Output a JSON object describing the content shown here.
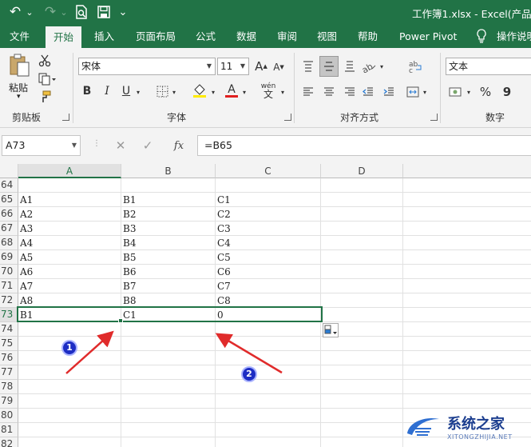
{
  "window": {
    "title": "工作簿1.xlsx  -  Excel(产品"
  },
  "quick_access": {
    "undo_icon": "↶",
    "redo_icon": "↷",
    "dropdown_icon": "⌄"
  },
  "tabs": [
    {
      "label": "文件"
    },
    {
      "label": "开始"
    },
    {
      "label": "插入"
    },
    {
      "label": "页面布局"
    },
    {
      "label": "公式"
    },
    {
      "label": "数据"
    },
    {
      "label": "审阅"
    },
    {
      "label": "视图"
    },
    {
      "label": "帮助"
    },
    {
      "label": "Power Pivot"
    },
    {
      "label": "操作说明"
    }
  ],
  "ribbon": {
    "clipboard": {
      "group_label": "剪贴板",
      "paste_label": "粘贴"
    },
    "font": {
      "group_label": "字体",
      "font_name": "宋体",
      "font_size": "11",
      "bold": "B",
      "italic": "I",
      "underline": "U",
      "grow": "A",
      "shrink": "A",
      "color_letter": "A",
      "phonetic": "wén",
      "accent_color": "#e02020",
      "highlight_color": "#ffeb00"
    },
    "alignment": {
      "group_label": "对齐方式"
    },
    "number": {
      "group_label": "数字",
      "format": "文本",
      "percent": "%",
      "comma": "9"
    }
  },
  "formula_bar": {
    "name_box": "A73",
    "fx": "fx",
    "formula": "=B65"
  },
  "sheet": {
    "columns": [
      "A",
      "B",
      "C",
      "D"
    ],
    "rows": [
      {
        "num": "64",
        "cells": [
          "",
          "",
          ""
        ]
      },
      {
        "num": "65",
        "cells": [
          "A1",
          "B1",
          "C1"
        ]
      },
      {
        "num": "66",
        "cells": [
          "A2",
          "B2",
          "C2"
        ]
      },
      {
        "num": "67",
        "cells": [
          "A3",
          "B3",
          "C3"
        ]
      },
      {
        "num": "68",
        "cells": [
          "A4",
          "B4",
          "C4"
        ]
      },
      {
        "num": "69",
        "cells": [
          "A5",
          "B5",
          "C5"
        ]
      },
      {
        "num": "70",
        "cells": [
          "A6",
          "B6",
          "C6"
        ]
      },
      {
        "num": "71",
        "cells": [
          "A7",
          "B7",
          "C7"
        ]
      },
      {
        "num": "72",
        "cells": [
          "A8",
          "B8",
          "C8"
        ]
      },
      {
        "num": "73",
        "cells": [
          "B1",
          "C1",
          "0"
        ]
      },
      {
        "num": "74",
        "cells": [
          "",
          "",
          ""
        ]
      },
      {
        "num": "75",
        "cells": [
          "",
          "",
          ""
        ]
      },
      {
        "num": "76",
        "cells": [
          "",
          "",
          ""
        ]
      },
      {
        "num": "77",
        "cells": [
          "",
          "",
          ""
        ]
      },
      {
        "num": "78",
        "cells": [
          "",
          "",
          ""
        ]
      },
      {
        "num": "79",
        "cells": [
          "",
          "",
          ""
        ]
      },
      {
        "num": "80",
        "cells": [
          "",
          "",
          ""
        ]
      },
      {
        "num": "81",
        "cells": [
          "",
          "",
          ""
        ]
      },
      {
        "num": "82",
        "cells": [
          "",
          "",
          ""
        ]
      }
    ]
  },
  "annotations": {
    "badge1": "1",
    "badge2": "2",
    "arrow_color": "#e02b2b"
  },
  "watermark": {
    "site": "系统之家",
    "url": "XITONGZHIJIA.NET"
  },
  "colors": {
    "excel_green": "#217346"
  }
}
